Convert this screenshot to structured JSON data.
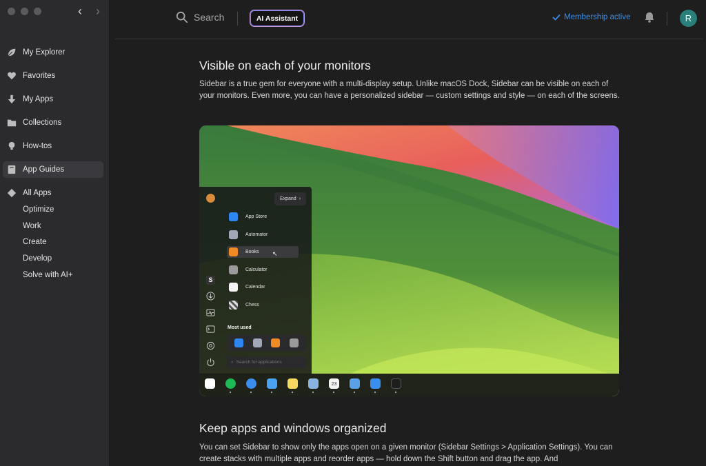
{
  "sidebar": {
    "items": [
      {
        "label": "My Explorer",
        "icon": "leaf-icon"
      },
      {
        "label": "Favorites",
        "icon": "heart-icon"
      },
      {
        "label": "My Apps",
        "icon": "download-arrow-icon"
      },
      {
        "label": "Collections",
        "icon": "folder-icon"
      },
      {
        "label": "How-tos",
        "icon": "lightbulb-icon"
      },
      {
        "label": "App Guides",
        "icon": "book-icon",
        "active": true
      },
      {
        "label": "All Apps",
        "icon": "diamond-icon"
      }
    ],
    "subitems": [
      "Optimize",
      "Work",
      "Create",
      "Develop",
      "Solve with AI+"
    ]
  },
  "topbar": {
    "search_label": "Search",
    "ai_button": "AI Assistant",
    "membership": "Membership active",
    "avatar_initial": "R"
  },
  "article": {
    "section1_title": "Visible on each of your monitors",
    "section1_body": "Sidebar is a true gem for everyone with a multi-display setup. Unlike macOS Dock, Sidebar can be visible on each of your monitors. Even more, you can have a personalized sidebar — custom settings and style — on each of the screens.",
    "section2_title": "Keep apps and windows organized",
    "section2_body": "You can set Sidebar to show only the apps open on a given monitor (Sidebar Settings > Application Settings). You can create stacks with multiple apps and reorder apps — hold down the Shift button and drag the app. And"
  },
  "screenshot": {
    "expand_label": "Expand",
    "apps": [
      "App Store",
      "Automator",
      "Books",
      "Calculator",
      "Calendar",
      "Chess"
    ],
    "most_used_label": "Most used",
    "search_placeholder": "Search for applications",
    "calendar_day": "23"
  },
  "colors": {
    "accent_blue": "#3b8fe8",
    "avatar_bg": "#2a7f7a",
    "sidebar_bg": "#2b2b2e",
    "main_bg": "#1e1e1e"
  }
}
